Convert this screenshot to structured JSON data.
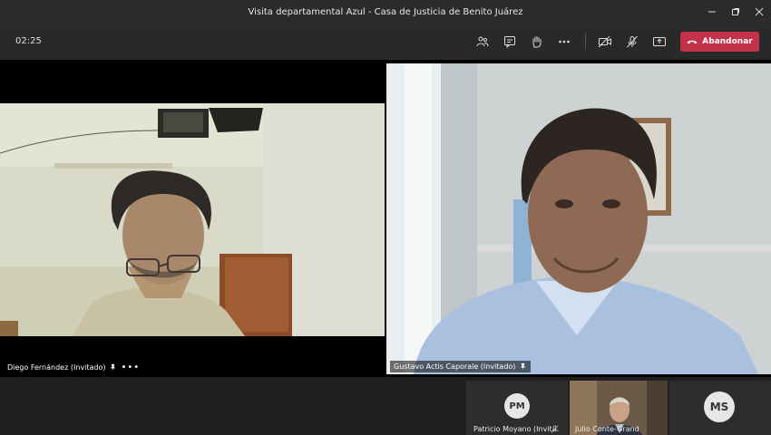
{
  "window": {
    "title": "Visita departamental Azul - Casa de Justicia de Benito Juárez"
  },
  "toolbar": {
    "timer": "02:25",
    "leave_label": "Abandonar"
  },
  "participants": {
    "main_left": {
      "name": "Diego Fernández (Invitado)"
    },
    "main_right": {
      "name": "Gustavo Actis Caporale (Invitado)"
    },
    "tiles": [
      {
        "initials": "PM",
        "name": "Patricio Moyano (Invit..."
      },
      {
        "name": "Julio Conte-Grand"
      },
      {
        "initials": "MS"
      }
    ]
  },
  "colors": {
    "leave": "#c4314b",
    "background": "#1f1f1f",
    "avatar_bg": "#e6e6e6"
  }
}
